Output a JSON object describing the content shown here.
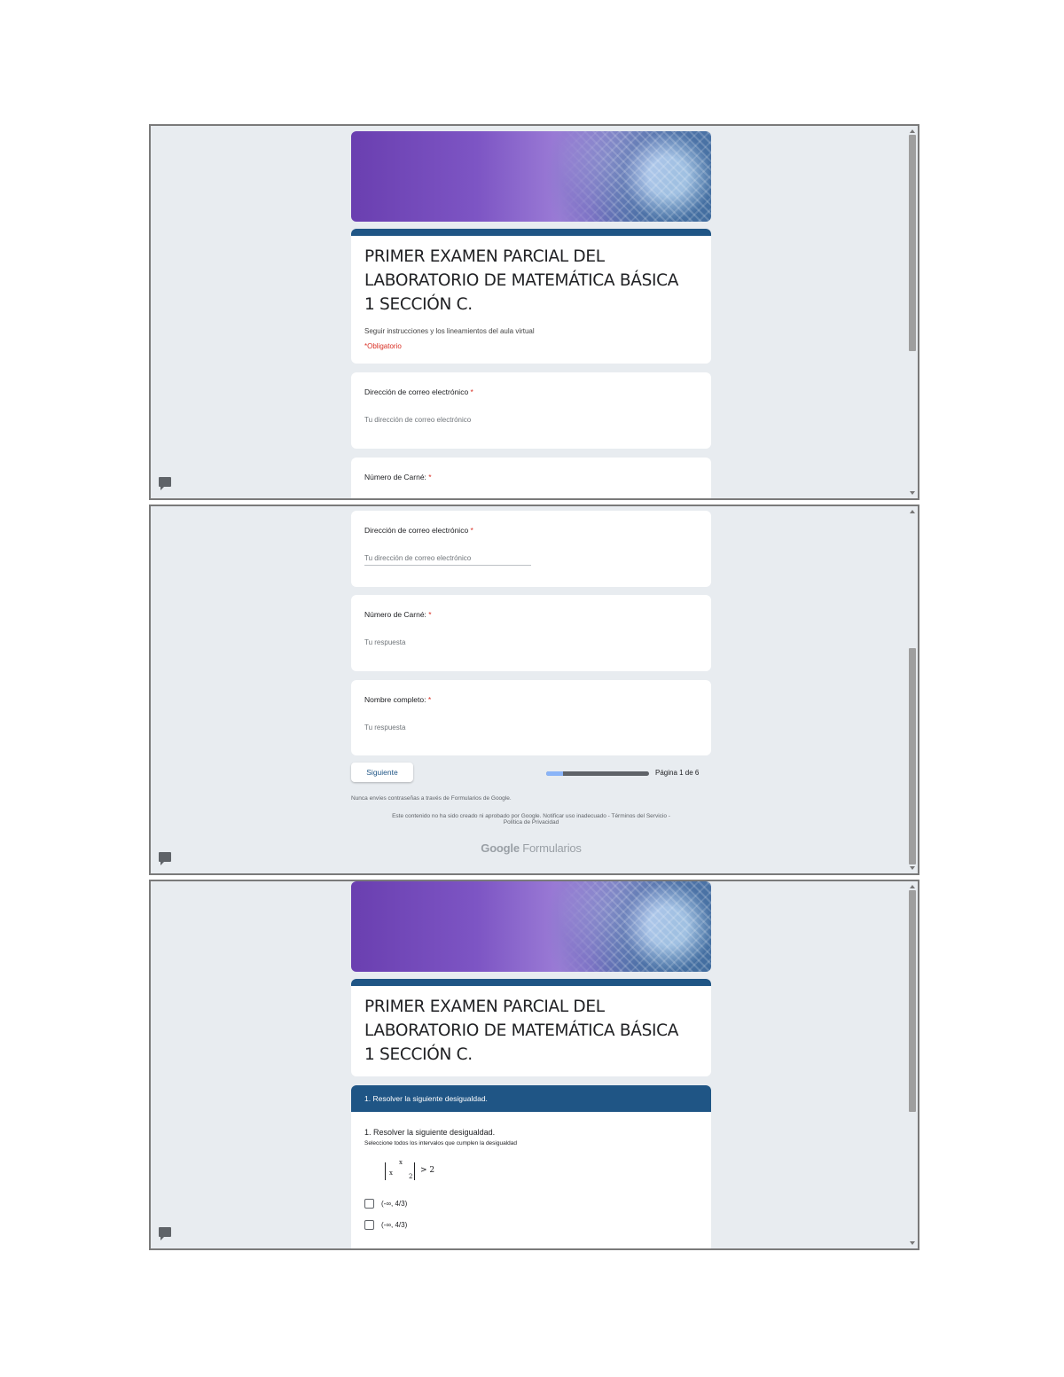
{
  "form": {
    "title_lines": [
      "PRIMER EXAMEN PARCIAL DEL",
      "LABORATORIO DE MATEMÁTICA BÁSICA",
      "1 SECCIÓN C."
    ],
    "subtitle": "Seguir instrucciones y los lineamientos del aula virtual",
    "required_note": "*Obligatorio",
    "required_star": "*"
  },
  "questions": {
    "email": {
      "label": "Dirección de correo electrónico",
      "placeholder": "Tu dirección de correo electrónico"
    },
    "carnet": {
      "label": "Número de Carné:",
      "placeholder": "Tu respuesta"
    },
    "nombre": {
      "label": "Nombre completo:",
      "placeholder": "Tu respuesta"
    }
  },
  "navigation": {
    "next_button": "Siguiente",
    "page_label": "Página 1 de 6",
    "progress": 0.16
  },
  "footer": {
    "password_note": "Nunca envíes contraseñas a través de Formularios de Google.",
    "disclaimer_line1": "Este contenido no ha sido creado ni aprobado por Google. Notificar uso inadecuado - Términos del Servicio -",
    "disclaimer_line2": "Política de Privacidad",
    "brand_strong": "Google",
    "brand_light": "Formularios"
  },
  "section": {
    "header": "1. Resolver la siguiente desigualdad.",
    "question_title": "1. Resolver la siguiente desigualdad.",
    "question_desc": "Seleccione todos los intervalos que cumplen la desigualdad",
    "formula": {
      "num": "x",
      "den_left": "x",
      "den_right": "2",
      "rhs": "> 2"
    },
    "options": [
      "(-∞, 4/3)",
      "(-∞, 4/3)"
    ]
  },
  "icons": {
    "feedback": "chat-feedback-icon"
  },
  "colors": {
    "theme": "#1f5585",
    "required": "#d93025",
    "background": "#e8ecf0"
  }
}
